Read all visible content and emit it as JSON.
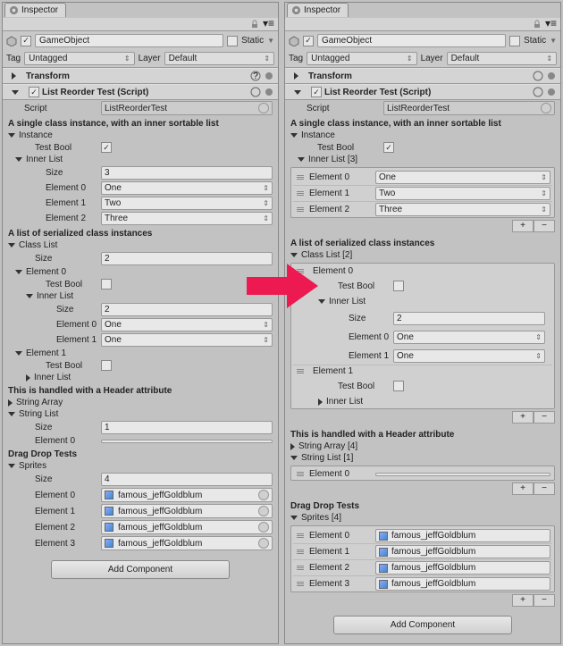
{
  "inspector_tab": "Inspector",
  "gameobject_name": "GameObject",
  "static_label": "Static",
  "tag_label": "Tag",
  "tag_value": "Untagged",
  "layer_label": "Layer",
  "layer_value": "Default",
  "transform_title": "Transform",
  "script_comp_title": "List Reorder Test (Script)",
  "script_label": "Script",
  "script_value": "ListReorderTest",
  "sec1": "A single class instance, with an inner sortable list",
  "instance_label": "Instance",
  "testbool_label": "Test Bool",
  "innerlist_label": "Inner List",
  "innerlist3_label": "Inner List [3]",
  "size_label": "Size",
  "size3": "3",
  "el0": "Element 0",
  "el1": "Element 1",
  "el2": "Element 2",
  "el3": "Element 3",
  "one": "One",
  "two": "Two",
  "three": "Three",
  "sec2": "A list of serialized class instances",
  "classlist_label": "Class List",
  "classlist2_label": "Class List [2]",
  "size2": "2",
  "size1": "1",
  "size4": "4",
  "sec3": "This is handled with a Header attribute",
  "stringarray_label": "String Array",
  "stringarray4_label": "String Array [4]",
  "stringlist_label": "String List",
  "stringlist1_label": "String List [1]",
  "sec4": "Drag Drop Tests",
  "sprites_label": "Sprites",
  "sprites4_label": "Sprites [4]",
  "sprite_name": "famous_jeffGoldblum",
  "add_component": "Add Component"
}
